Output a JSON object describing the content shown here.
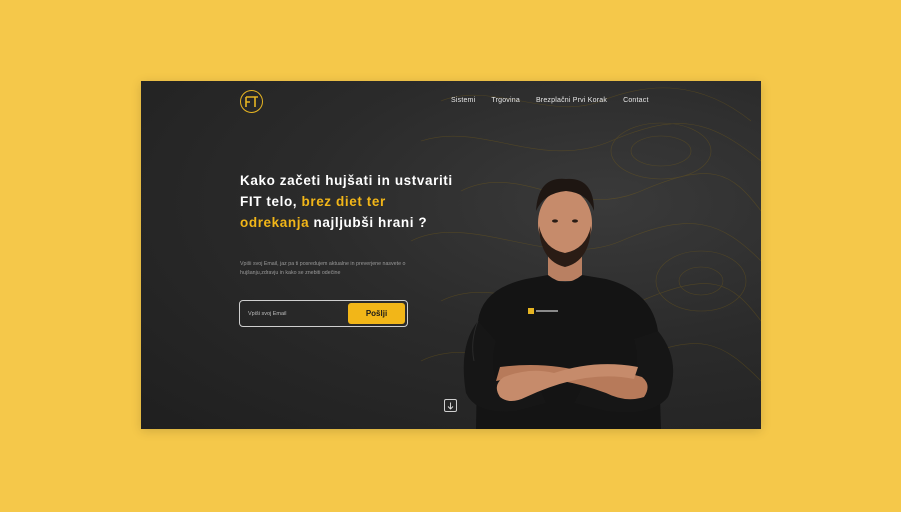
{
  "nav": {
    "items": [
      "Sistemi",
      "Trgovina",
      "Brezplačni Prvi Korak",
      "Contact"
    ]
  },
  "hero": {
    "headline_part1": "Kako začeti hujšati in ustvariti FIT telo, ",
    "headline_highlight": "brez diet ter odrekanja",
    "headline_part2": " najljubši hrani ?",
    "subtext": "Vpiši svoj Email, jaz pa ti posredujem aktualne in preverjene nasvete o hujšanju,zdravju in kako se znebiti odečine",
    "email_placeholder": "Vpiši svoj Email",
    "submit_label": "Pošlji"
  },
  "icons": {
    "logo": "ft-monogram-logo",
    "scroll": "arrow-down-icon"
  },
  "colors": {
    "accent": "#f2b618",
    "background": "#f5c84a",
    "panel": "#2b2b2b"
  }
}
